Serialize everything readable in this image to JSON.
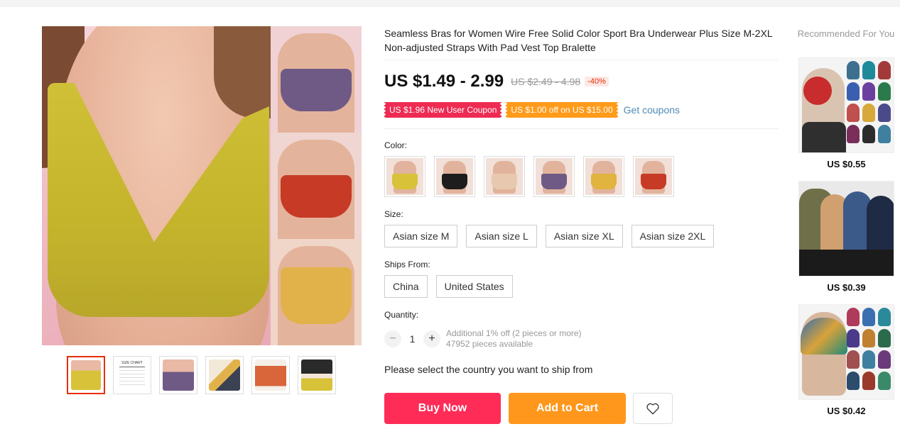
{
  "product": {
    "title": "Seamless Bras for Women Wire Free Solid Color Sport Bra Underwear Plus Size M-2XL Non-adjusted Straps With Pad Vest Top Bralette",
    "price": "US $1.49 - 2.99",
    "original_price": "US $2.49 - 4.98",
    "discount": "-40%"
  },
  "coupons": {
    "new_user": "US $1.96 New User Coupon",
    "store": "US $1.00 off on US $15.00",
    "get_coupons_link": "Get coupons"
  },
  "color": {
    "label": "Color:",
    "swatches": [
      {
        "name": "yellow",
        "color": "#d7c23a"
      },
      {
        "name": "black",
        "color": "#1d1d1d"
      },
      {
        "name": "beige",
        "color": "#e8c9b0"
      },
      {
        "name": "purple",
        "color": "#6f5a86"
      },
      {
        "name": "mustard",
        "color": "#e0b43e"
      },
      {
        "name": "red",
        "color": "#c63a26"
      }
    ]
  },
  "size": {
    "label": "Size:",
    "options": [
      "Asian size M",
      "Asian size L",
      "Asian size XL",
      "Asian size 2XL"
    ]
  },
  "ships_from": {
    "label": "Ships From:",
    "options": [
      "China",
      "United States"
    ]
  },
  "quantity": {
    "label": "Quantity:",
    "minus": "−",
    "plus": "+",
    "value": "1",
    "discount_note": "Additional 1% off (2 pieces or more)",
    "available": "47952 pieces available"
  },
  "ship_message": "Please select the country you want to ship from",
  "actions": {
    "buy_now": "Buy Now",
    "add_to_cart": "Add to Cart",
    "wishlist_icon": "heart-icon"
  },
  "recommended": {
    "title": "Recommended For You",
    "items": [
      {
        "price": "US $0.55"
      },
      {
        "price": "US $0.39"
      },
      {
        "price": "US $0.42"
      }
    ]
  },
  "gallery": {
    "thumbnail_count": 6,
    "active_thumbnail": 0,
    "size_chart_caption": "SIZE CHART"
  },
  "colors": {
    "accent_red": "#ff2c57",
    "accent_orange": "#ff971d",
    "coupon_red": "#ee2b53",
    "coupon_orange": "#ff9b19",
    "link_blue": "#4f8ab5",
    "active_border": "#e62e04"
  }
}
